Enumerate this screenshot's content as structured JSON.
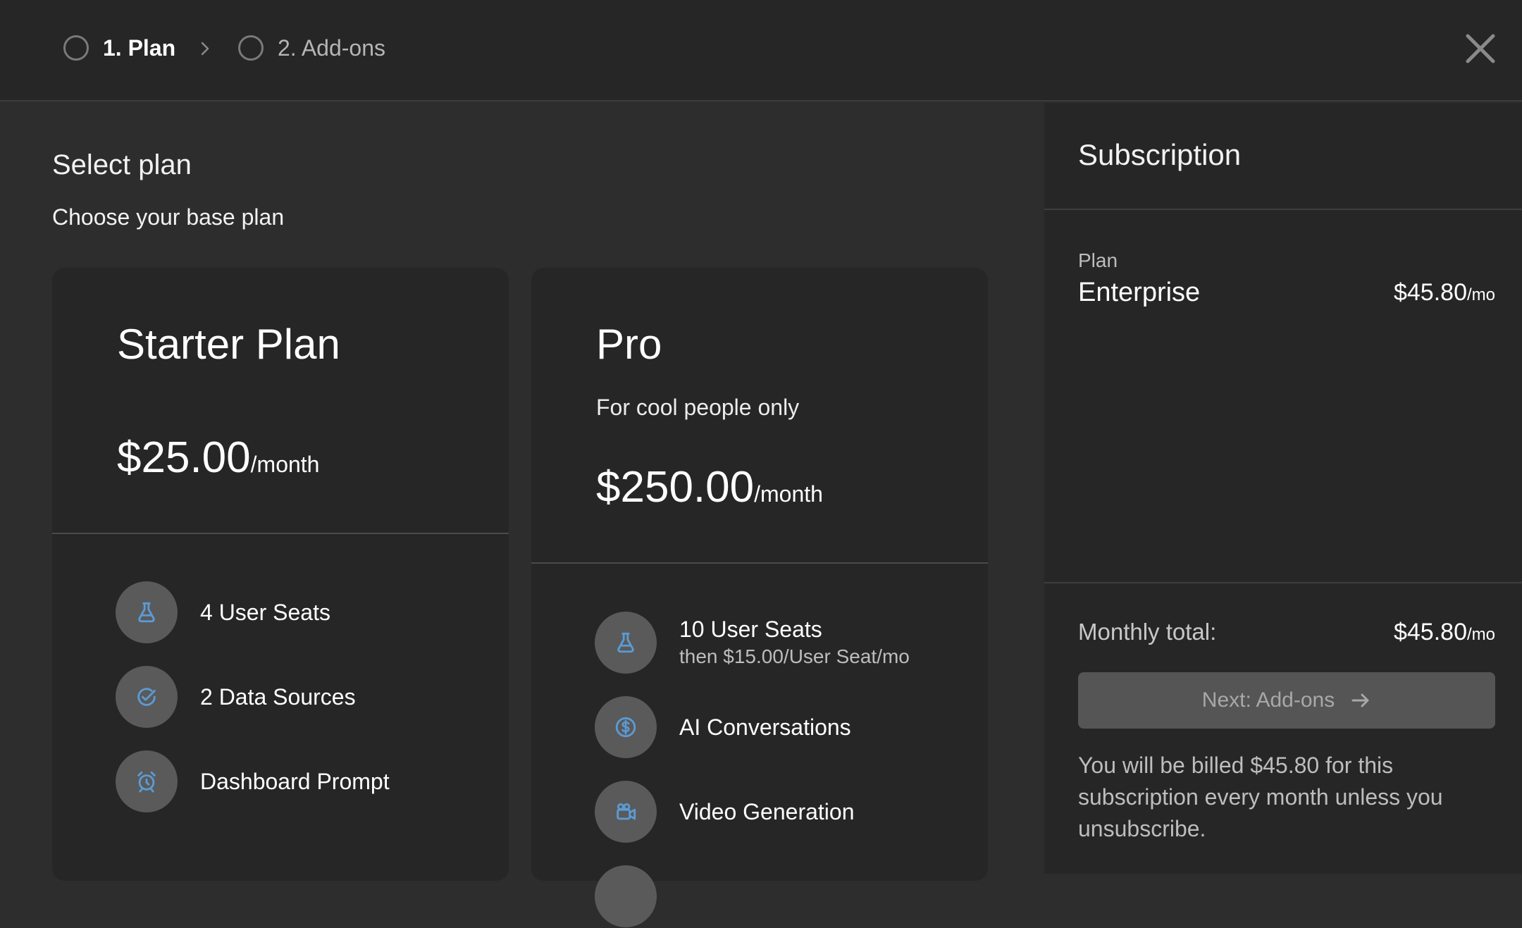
{
  "wizard": {
    "steps": [
      {
        "label": "1. Plan"
      },
      {
        "label": "2. Add-ons"
      }
    ]
  },
  "main": {
    "title": "Select plan",
    "subtitle": "Choose your base plan"
  },
  "plans": [
    {
      "name": "Starter Plan",
      "description": "",
      "price": "$25.00",
      "period": "/month",
      "features": [
        {
          "icon": "flask-icon",
          "label": "4 User Seats",
          "sub": ""
        },
        {
          "icon": "check-circle-icon",
          "label": "2 Data Sources",
          "sub": ""
        },
        {
          "icon": "alarm-clock-icon",
          "label": "Dashboard Prompt",
          "sub": ""
        }
      ]
    },
    {
      "name": "Pro",
      "description": "For cool people only",
      "price": "$250.00",
      "period": "/month",
      "features": [
        {
          "icon": "flask-icon",
          "label": "10 User Seats",
          "sub": "then $15.00/User Seat/mo"
        },
        {
          "icon": "dollar-circle-icon",
          "label": "AI Conversations",
          "sub": ""
        },
        {
          "icon": "video-camera-icon",
          "label": "Video Generation",
          "sub": ""
        }
      ]
    }
  ],
  "subscription": {
    "title": "Subscription",
    "plan_caption": "Plan",
    "plan_name": "Enterprise",
    "plan_price": "$45.80",
    "plan_period": "/mo",
    "total_label": "Monthly total:",
    "total_price": "$45.80",
    "total_period": "/mo",
    "next_button": "Next: Add-ons",
    "billing_note": "You will be billed $45.80 for this subscription every month unless you unsubscribe."
  },
  "colors": {
    "background": "#2d2d2d",
    "header": "#262626",
    "card": "#262626",
    "icon_circle": "#5a5a5a",
    "icon_accent": "#5b9bd5",
    "button": "#555555"
  }
}
